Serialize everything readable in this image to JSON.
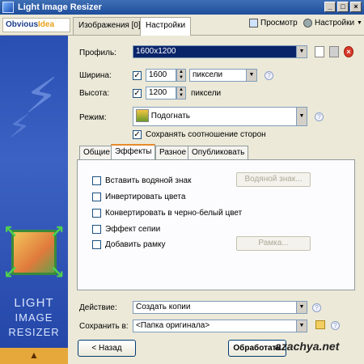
{
  "window": {
    "title": "Light Image Resizer"
  },
  "toolbar": {
    "logo_part1": "Obvious",
    "logo_part2": "Idea",
    "tab_images": "Изображения [0]",
    "tab_settings": "Настройки",
    "preview_label": "Просмотр",
    "settings_label": "Настройки"
  },
  "sidebar": {
    "brand_line1": "LIGHT",
    "brand_line2": "IMAGE",
    "brand_line3": "RESIZER"
  },
  "form": {
    "profile_label": "Профиль:",
    "profile_value": "1600x1200",
    "width_label": "Ширина:",
    "width_value": "1600",
    "width_unit": "пиксели",
    "height_label": "Высота:",
    "height_value": "1200",
    "height_unit": "пиксели",
    "mode_label": "Режим:",
    "mode_value": "Подогнать",
    "keep_ratio_label": "Сохранять соотношение сторон"
  },
  "tabs": {
    "general": "Общие",
    "effects": "Эффекты",
    "misc": "Разное",
    "publish": "Опубликовать"
  },
  "effects": {
    "watermark_label": "Вставить водяной знак",
    "watermark_button": "Водяной знак...",
    "invert_label": "Инвертировать цвета",
    "grayscale_label": "Конвертировать в черно-белый цвет",
    "sepia_label": "Эффект сепии",
    "frame_label": "Добавить рамку",
    "frame_button": "Рамка..."
  },
  "bottom": {
    "action_label": "Действие:",
    "action_value": "Создать копии",
    "save_label": "Сохранить в:",
    "save_value": "<Папка оригинала>",
    "back_button": "< Назад",
    "process_button": "Обработать",
    "watermark_text": "azachya.net"
  }
}
